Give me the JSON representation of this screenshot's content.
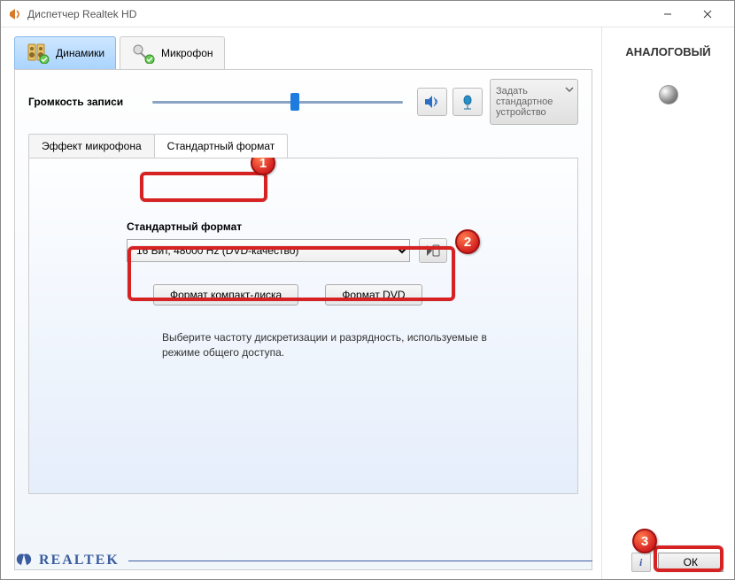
{
  "window": {
    "title": "Диспетчер Realtek HD"
  },
  "tabs": {
    "speakers": "Динамики",
    "mic": "Микрофон"
  },
  "recording": {
    "label": "Громкость записи",
    "set_default": "Задать стандартное устройство"
  },
  "inner_tabs": {
    "effect": "Эффект микрофона",
    "format": "Стандартный формат"
  },
  "format": {
    "label": "Стандартный формат",
    "selected": "16 Бит, 48000 Hz (DVD-качество)",
    "preset_cd": "Формат компакт-диска",
    "preset_dvd": "Формат DVD",
    "hint": "Выберите частоту дискретизации и разрядность, используемые в режиме общего доступа."
  },
  "side": {
    "title": "АНАЛОГОВЫЙ"
  },
  "brand": "REALTEK",
  "ok": "ОК",
  "annotations": {
    "n1": "1",
    "n2": "2",
    "n3": "3"
  }
}
